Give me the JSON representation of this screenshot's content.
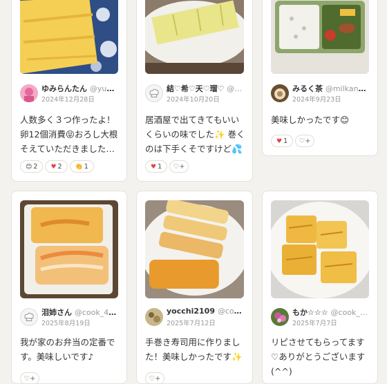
{
  "cards": [
    {
      "user_name": "ゆみらんたん",
      "user_id": "@yum…",
      "date": "2024年12月28日",
      "comment": "人数多く３つ作ったよ！卵12個消費😝おろし大根そえていただきました…",
      "reactions": [
        {
          "icon": "smile-emoji",
          "glyph": "😊",
          "count": "2"
        },
        {
          "icon": "heart-emoji",
          "glyph": "♥",
          "count": "2"
        },
        {
          "icon": "clap-emoji",
          "glyph": "👏",
          "count": "1"
        }
      ]
    },
    {
      "user_name": "結♡希♡天♡瑠♡",
      "user_id": "@…",
      "date": "2024年10月20日",
      "comment": "居酒屋で出てきてもいいくらいの味でした✨ 巻くのは下手くそですけど💦",
      "reactions": [
        {
          "icon": "heart-emoji",
          "glyph": "♥",
          "count": "1"
        }
      ]
    },
    {
      "user_name": "みるく茶",
      "user_id": "@milkandt…",
      "date": "2024年9月23日",
      "comment": "美味しかったです😊",
      "reactions": [
        {
          "icon": "heart-emoji",
          "glyph": "♥",
          "count": "1"
        }
      ]
    },
    {
      "user_name": "泪姉さん",
      "user_id": "@cook_40…",
      "date": "2025年8月19日",
      "comment": "我が家のお弁当の定番です。美味しいです♪",
      "reactions": []
    },
    {
      "user_name": "yocchi2109",
      "user_id": "@cook_…",
      "date": "2025年7月12日",
      "comment": "手巻き寿司用に作りました！美味しかったです✨",
      "reactions": []
    },
    {
      "user_name": "もか☆☆☆",
      "user_id": "@cook_…",
      "date": "2025年7月7日",
      "comment": "リピさせてもらってます♡ありがとうございます(^^)",
      "reactions": []
    }
  ],
  "colors": {
    "background": "#f3f2ee",
    "card_border": "#e4e1da",
    "heart": "#e0464a",
    "muted_text": "#999999"
  }
}
